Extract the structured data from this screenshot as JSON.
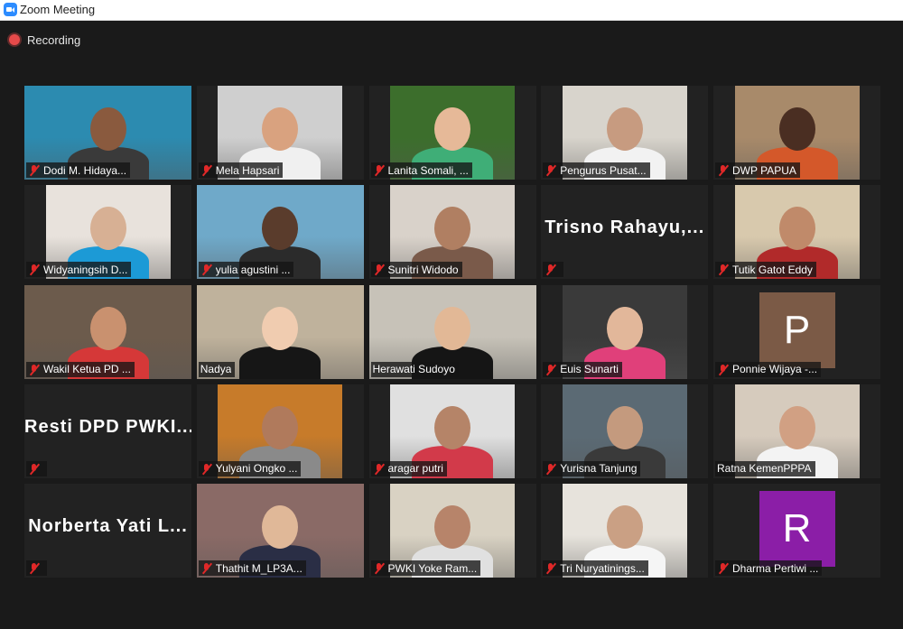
{
  "window": {
    "title": "Zoom Meeting"
  },
  "status": {
    "recording": "Recording"
  },
  "participants": [
    {
      "name": "Dodi M. Hidaya...",
      "muted": true,
      "bg": "#2c8bb0",
      "skin": "#8a5a3e",
      "shirt": "#3a3a3a"
    },
    {
      "name": "Mela Hapsari",
      "muted": true,
      "bg": "#cfcfcf",
      "skin": "#d9a27f",
      "shirt": "#f0f0f0"
    },
    {
      "name": "Lanita Somali, ...",
      "muted": true,
      "bg": "#3c6e2c",
      "skin": "#e6b998",
      "shirt": "#3fae77"
    },
    {
      "name": "Pengurus Pusat...",
      "muted": true,
      "bg": "#d8d4cc",
      "skin": "#c79b80",
      "shirt": "#f2f2f2"
    },
    {
      "name": "DWP PAPUA",
      "muted": true,
      "bg": "#a88a6a",
      "skin": "#4a2e22",
      "shirt": "#d4582a"
    },
    {
      "name": "Widyaningsih D...",
      "muted": true,
      "bg": "#e8e2dc",
      "skin": "#d7b094",
      "shirt": "#1c9ad6"
    },
    {
      "name": "yulia agustini ...",
      "muted": true,
      "bg": "#6fa9c9",
      "skin": "#5a3c2c",
      "shirt": "#2b2b2b"
    },
    {
      "name": "Sunitri Widodo",
      "muted": true,
      "bg": "#d9d2ca",
      "skin": "#b07f62",
      "shirt": "#7a5a4a"
    },
    {
      "name": "Trisno Rahayu,...",
      "muted": true,
      "video": false,
      "bigname": "Trisno  Rahayu,..."
    },
    {
      "name": "Tutik Gatot Eddy",
      "muted": true,
      "bg": "#d8c9ad",
      "skin": "#c08a6a",
      "shirt": "#b12a2a"
    },
    {
      "name": "Wakil Ketua PD ...",
      "muted": true,
      "bg": "#6c5b4c",
      "skin": "#c9916f",
      "shirt": "#d53838"
    },
    {
      "name": "Nadya",
      "muted": false,
      "active": true,
      "bg": "#bfb29c",
      "skin": "#f0ccb0",
      "shirt": "#161616"
    },
    {
      "name": "Herawati Sudoyo",
      "muted": false,
      "bg": "#c7c2b8",
      "skin": "#e2b896",
      "shirt": "#151515"
    },
    {
      "name": "Euis Sunarti",
      "muted": true,
      "bg": "#3a3a3a",
      "skin": "#e2b79a",
      "shirt": "#e0407a"
    },
    {
      "name": "Ponnie Wijaya -...",
      "muted": true,
      "video": false,
      "avatar": "P",
      "avatar_color": "#7b5a46"
    },
    {
      "name": "Resti DPD PWKI...",
      "muted": true,
      "video": false,
      "bigname": "Resti  DPD  PWKI..."
    },
    {
      "name": "Yulyani Ongko ...",
      "muted": true,
      "bg": "#c77b2a",
      "skin": "#b07a5c",
      "shirt": "#8a8a8a"
    },
    {
      "name": "aragar putri",
      "muted": true,
      "bg": "#e0e0e0",
      "skin": "#b58468",
      "shirt": "#d23a4a"
    },
    {
      "name": "Yurisna Tanjung",
      "muted": true,
      "bg": "#5b6a74",
      "skin": "#c49a7e",
      "shirt": "#3a3a3a"
    },
    {
      "name": "Ratna KemenPPPA",
      "muted": false,
      "bg": "#d6cbbd",
      "skin": "#d1a083",
      "shirt": "#f3f3f3"
    },
    {
      "name": "Norberta Yati L...",
      "muted": true,
      "video": false,
      "bigname": "Norberta  Yati  L..."
    },
    {
      "name": "Thathit M_LP3A...",
      "muted": true,
      "bg": "#8a6a66",
      "skin": "#e0b898",
      "shirt": "#2a2e45"
    },
    {
      "name": "PWKI Yoke Ram...",
      "muted": true,
      "bg": "#d9d2c3",
      "skin": "#b7846a",
      "shirt": "#e0e0e0"
    },
    {
      "name": "Tri Nuryatinings...",
      "muted": true,
      "bg": "#e7e3dc",
      "skin": "#caa084",
      "shirt": "#f5f5f5"
    },
    {
      "name": "Dharma Pertiwi ...",
      "muted": true,
      "video": false,
      "avatar": "R",
      "avatar_color": "#8b1ea7"
    }
  ]
}
